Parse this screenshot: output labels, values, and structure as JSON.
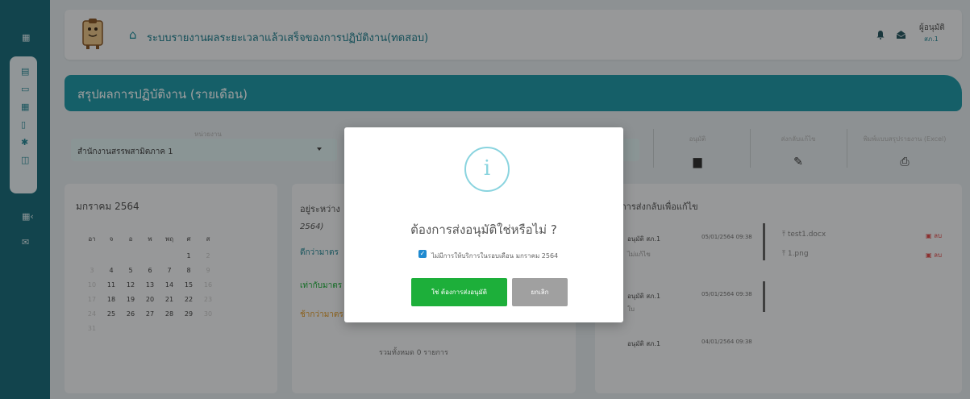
{
  "app": {
    "title": "ระบบรายงานผลระยะเวลาแล้วเสร็จของการปฏิบัติงาน(ทดสอบ)"
  },
  "header": {
    "user_name": "ผู้อนุมัติ",
    "user_sub": "สภ.1"
  },
  "banner": {
    "title": "สรุปผลการปฏิบัติงาน (รายเดือน)"
  },
  "filters": {
    "dept_label": "หน่วยงาน",
    "dept_value": "สำนักงานสรรพสามิตภาค 1"
  },
  "actions": [
    {
      "label": "อนุมัติ",
      "icon": "clipboard-icon"
    },
    {
      "label": "ส่งกลับแก้ไข",
      "icon": "pencil-icon"
    },
    {
      "label": "พิมพ์แบบสรุปรายงาน (Excel)",
      "icon": "printer-icon"
    }
  ],
  "calendar": {
    "title": "มกราคม 2564",
    "weekdays": [
      "อา",
      "จ",
      "อ",
      "พ",
      "พฤ",
      "ศ",
      "ส"
    ],
    "weeks": [
      [
        "",
        "",
        "",
        "",
        "",
        "1",
        "2"
      ],
      [
        "3",
        "4",
        "5",
        "6",
        "7",
        "8",
        "9"
      ],
      [
        "10",
        "11",
        "12",
        "13",
        "14",
        "15",
        "16"
      ],
      [
        "17",
        "18",
        "19",
        "20",
        "21",
        "22",
        "23"
      ],
      [
        "24",
        "25",
        "26",
        "27",
        "28",
        "29",
        "30"
      ],
      [
        "31",
        "",
        "",
        "",
        "",
        "",
        ""
      ]
    ]
  },
  "middle": {
    "title": "อยู่ระหว่าง",
    "year": "2564)",
    "items": [
      {
        "text": "ดีกว่ามาตร",
        "color": "#2a8a98"
      },
      {
        "text": "เท่ากับมาตร",
        "color": "#1daf3a"
      },
      {
        "text": "ช้ากว่ามาตร",
        "color": "#e09a2a"
      }
    ],
    "total": "รวมทั้งหมด 0 รายการ"
  },
  "right": {
    "title": "การส่งกลับเพื่อแก้ไข",
    "entries": [
      {
        "name": "อนุมัติ สภ.1",
        "date": "05/01/2564 09:38",
        "note": "ไม่แก้ไข"
      },
      {
        "name": "อนุมัติ สภ.1",
        "date": "05/01/2564 09:38",
        "note": "ใบ"
      },
      {
        "name": "อนุมัติ สภ.1",
        "date": "04/01/2564 09:38",
        "note": ""
      }
    ],
    "files": [
      {
        "name": "test1.docx",
        "delete": "ลบ"
      },
      {
        "name": "1.png",
        "delete": "ลบ"
      }
    ]
  },
  "modal": {
    "icon": "info-icon",
    "title": "ต้องการส่งอนุมัติใช่หรือไม่ ?",
    "checkbox_label": "ไม่มีการให้บริการในรอบเดือน มกราคม 2564",
    "checkbox_checked": true,
    "confirm_label": "ใช่ ต้องการส่งอนุมัติ",
    "cancel_label": "ยกเลิก"
  },
  "colors": {
    "primary": "#239aa8",
    "sidebar": "#1e6f7d",
    "confirm": "#1daf3a",
    "cancel": "#a0a0a0"
  }
}
